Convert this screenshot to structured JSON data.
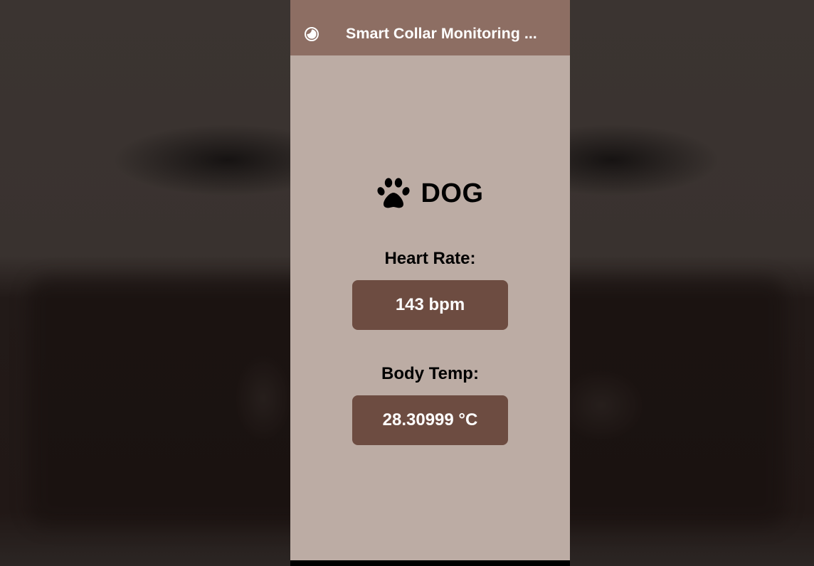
{
  "app_bar": {
    "title": "Smart Collar Monitoring ...",
    "theme_icon": "half-moon-contrast-icon"
  },
  "animal": {
    "icon": "paw-icon",
    "name": "DOG"
  },
  "heart_rate": {
    "label": "Heart Rate:",
    "value": "143 bpm"
  },
  "body_temp": {
    "label": "Body Temp:",
    "value": "28.30999 °C"
  },
  "colors": {
    "app_bar": "#8d6e63",
    "background": "#bcaca4",
    "value_box": "#6d4c41",
    "text_on_box": "#ffffff"
  }
}
